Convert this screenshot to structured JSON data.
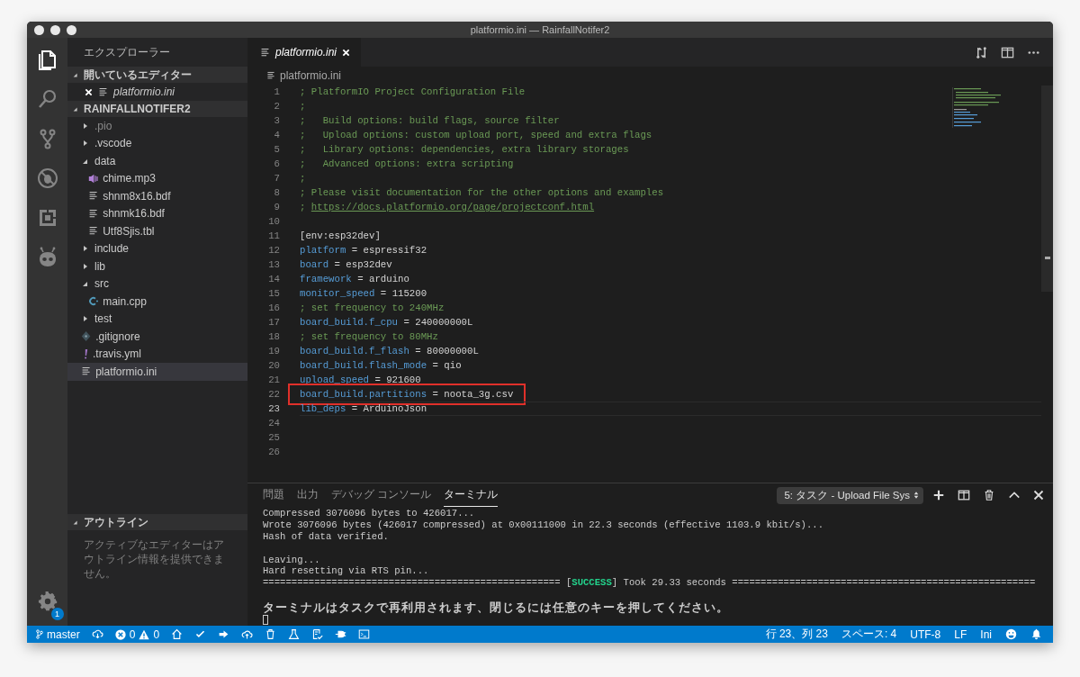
{
  "window": {
    "title": "platformio.ini — RainfallNotifer2"
  },
  "activity_bar": {
    "items": [
      {
        "kind": "files",
        "selected": true
      },
      {
        "kind": "search",
        "selected": false
      },
      {
        "kind": "scm",
        "selected": false
      },
      {
        "kind": "debug",
        "selected": false
      },
      {
        "kind": "extensions",
        "selected": false
      },
      {
        "kind": "platformio",
        "selected": false
      }
    ],
    "settings_badge": "1"
  },
  "explorer": {
    "title": "エクスプローラー",
    "open_editors": {
      "title": "開いているエディター",
      "expanded": true,
      "items": [
        {
          "name": "platformio.ini",
          "preview": true
        }
      ]
    },
    "project": {
      "title": "RAINFALLNOTIFER2",
      "expanded": true,
      "items": [
        {
          "name": ".pio",
          "kind": "folder",
          "expanded": false,
          "dimmed": true,
          "selected": false
        },
        {
          "name": ".vscode",
          "kind": "folder",
          "expanded": false,
          "dimmed": false,
          "selected": false
        },
        {
          "name": "data",
          "kind": "folder",
          "expanded": true,
          "dimmed": false,
          "selected": false,
          "children": [
            {
              "name": "chime.mp3",
              "kind": "audio",
              "dimmed": false,
              "selected": false
            },
            {
              "name": "shnm8x16.bdf",
              "kind": "text",
              "dimmed": false,
              "selected": false
            },
            {
              "name": "shnmk16.bdf",
              "kind": "text",
              "dimmed": false,
              "selected": false
            },
            {
              "name": "Utf8Sjis.tbl",
              "kind": "text",
              "dimmed": false,
              "selected": false
            }
          ]
        },
        {
          "name": "include",
          "kind": "folder",
          "expanded": false,
          "dimmed": false,
          "selected": false
        },
        {
          "name": "lib",
          "kind": "folder",
          "expanded": false,
          "dimmed": false,
          "selected": false
        },
        {
          "name": "src",
          "kind": "folder",
          "expanded": true,
          "dimmed": false,
          "selected": false,
          "children": [
            {
              "name": "main.cpp",
              "kind": "cpp",
              "dimmed": false,
              "selected": false
            }
          ]
        },
        {
          "name": "test",
          "kind": "folder",
          "expanded": false,
          "dimmed": false,
          "selected": false
        },
        {
          "name": ".gitignore",
          "kind": "git",
          "dimmed": false,
          "selected": false
        },
        {
          "name": ".travis.yml",
          "kind": "yaml",
          "dimmed": false,
          "selected": false
        },
        {
          "name": "platformio.ini",
          "kind": "text",
          "dimmed": false,
          "selected": true
        }
      ]
    },
    "outline": {
      "title": "アウトライン",
      "expanded": true,
      "message": "アクティブなエディターはアウトライン情報を提供できません。"
    }
  },
  "editor": {
    "tabs": [
      {
        "name": "platformio.ini",
        "preview": true,
        "selected": true
      }
    ],
    "breadcrumb": "platformio.ini",
    "lines": [
      {
        "number": "1",
        "current": false,
        "boxed": false,
        "tokens": [
          {
            "kind": "comment",
            "text": "; PlatformIO Project Configuration File"
          }
        ]
      },
      {
        "number": "2",
        "current": false,
        "boxed": false,
        "tokens": [
          {
            "kind": "comment",
            "text": ";"
          }
        ]
      },
      {
        "number": "3",
        "current": false,
        "boxed": false,
        "tokens": [
          {
            "kind": "comment",
            "text": ";   Build options: build flags, source filter"
          }
        ]
      },
      {
        "number": "4",
        "current": false,
        "boxed": false,
        "tokens": [
          {
            "kind": "comment",
            "text": ";   Upload options: custom upload port, speed and extra flags"
          }
        ]
      },
      {
        "number": "5",
        "current": false,
        "boxed": false,
        "tokens": [
          {
            "kind": "comment",
            "text": ";   Library options: dependencies, extra library storages"
          }
        ]
      },
      {
        "number": "6",
        "current": false,
        "boxed": false,
        "tokens": [
          {
            "kind": "comment",
            "text": ";   Advanced options: extra scripting"
          }
        ]
      },
      {
        "number": "7",
        "current": false,
        "boxed": false,
        "tokens": [
          {
            "kind": "comment",
            "text": ";"
          }
        ]
      },
      {
        "number": "8",
        "current": false,
        "boxed": false,
        "tokens": [
          {
            "kind": "comment",
            "text": "; Please visit documentation for the other options and examples"
          }
        ]
      },
      {
        "number": "9",
        "current": false,
        "boxed": false,
        "tokens": [
          {
            "kind": "comment",
            "text": "; "
          },
          {
            "kind": "link",
            "text": "https://docs.platformio.org/page/projectconf.html"
          }
        ]
      },
      {
        "number": "10",
        "current": false,
        "boxed": false
      },
      {
        "number": "11",
        "current": false,
        "boxed": false,
        "tokens": [
          {
            "kind": "value",
            "text": "[env:esp32dev]"
          }
        ]
      },
      {
        "number": "12",
        "current": false,
        "boxed": false,
        "tokens": [
          {
            "kind": "key",
            "text": "platform"
          },
          {
            "kind": "value",
            "text": " = espressif32"
          }
        ]
      },
      {
        "number": "13",
        "current": false,
        "boxed": false,
        "tokens": [
          {
            "kind": "key",
            "text": "board"
          },
          {
            "kind": "value",
            "text": " = esp32dev"
          }
        ]
      },
      {
        "number": "14",
        "current": false,
        "boxed": false,
        "tokens": [
          {
            "kind": "key",
            "text": "framework"
          },
          {
            "kind": "value",
            "text": " = arduino"
          }
        ]
      },
      {
        "number": "15",
        "current": false,
        "boxed": false,
        "tokens": [
          {
            "kind": "key",
            "text": "monitor_speed"
          },
          {
            "kind": "value",
            "text": " = 115200"
          }
        ]
      },
      {
        "number": "16",
        "current": false,
        "boxed": false,
        "tokens": [
          {
            "kind": "comment",
            "text": "; set frequency to 240MHz"
          }
        ]
      },
      {
        "number": "17",
        "current": false,
        "boxed": false,
        "tokens": [
          {
            "kind": "key",
            "text": "board_build.f_cpu"
          },
          {
            "kind": "value",
            "text": " = 240000000L"
          }
        ]
      },
      {
        "number": "18",
        "current": false,
        "boxed": false,
        "tokens": [
          {
            "kind": "comment",
            "text": "; set frequency to 80MHz"
          }
        ]
      },
      {
        "number": "19",
        "current": false,
        "boxed": false,
        "tokens": [
          {
            "kind": "key",
            "text": "board_build.f_flash"
          },
          {
            "kind": "value",
            "text": " = 80000000L"
          }
        ]
      },
      {
        "number": "20",
        "current": false,
        "boxed": false,
        "tokens": [
          {
            "kind": "key",
            "text": "board_build.flash_mode"
          },
          {
            "kind": "value",
            "text": " = qio"
          }
        ]
      },
      {
        "number": "21",
        "current": false,
        "boxed": false,
        "tokens": [
          {
            "kind": "key",
            "text": "upload_speed"
          },
          {
            "kind": "value",
            "text": " = 921600"
          }
        ]
      },
      {
        "number": "22",
        "current": false,
        "boxed": true,
        "tokens": [
          {
            "kind": "key",
            "text": "board_build.partitions"
          },
          {
            "kind": "value",
            "text": " = noota_3g.csv"
          }
        ]
      },
      {
        "number": "23",
        "current": true,
        "boxed": false,
        "tokens": [
          {
            "kind": "key",
            "text": "lib_deps"
          },
          {
            "kind": "value",
            "text": " = ArduinoJson"
          }
        ]
      },
      {
        "number": "24",
        "current": false,
        "boxed": false
      },
      {
        "number": "25",
        "current": false,
        "boxed": false
      },
      {
        "number": "26",
        "current": false,
        "boxed": false
      }
    ]
  },
  "panel": {
    "tabs": [
      {
        "label": "問題",
        "selected": false
      },
      {
        "label": "出力",
        "selected": false
      },
      {
        "label": "デバッグ コンソール",
        "selected": false
      },
      {
        "label": "ターミナル",
        "selected": true
      }
    ],
    "task_select": "5: タスク - Upload File Sys",
    "terminal": [
      {
        "kind": "text",
        "text": "Compressed 3076096 bytes to 426017..."
      },
      {
        "kind": "text",
        "text": "Wrote 3076096 bytes (426017 compressed) at 0x00111000 in 22.3 seconds (effective 1103.9 kbit/s)..."
      },
      {
        "kind": "text",
        "text": "Hash of data verified."
      },
      {
        "kind": "blank"
      },
      {
        "kind": "text",
        "text": "Leaving..."
      },
      {
        "kind": "text",
        "text": "Hard resetting via RTS pin..."
      },
      {
        "kind": "status",
        "before": "==================================================== [",
        "status": "SUCCESS",
        "after": "] Took 29.33 seconds ====================================================="
      },
      {
        "kind": "blank"
      },
      {
        "kind": "notice",
        "text": "ターミナルはタスクで再利用されます、閉じるには任意のキーを押してください。"
      },
      {
        "kind": "cursor"
      }
    ]
  },
  "status_bar": {
    "left": [
      {
        "kind": "branch",
        "text": "master"
      },
      {
        "kind": "sync"
      },
      {
        "kind": "problems",
        "errors": "0",
        "warnings": "0"
      },
      {
        "kind": "home"
      },
      {
        "kind": "check"
      },
      {
        "kind": "arrow"
      },
      {
        "kind": "upload"
      },
      {
        "kind": "trash"
      },
      {
        "kind": "flask"
      },
      {
        "kind": "checklist"
      },
      {
        "kind": "plug"
      },
      {
        "kind": "terminal"
      }
    ],
    "right": [
      {
        "kind": "text",
        "text": "行 23、列 23"
      },
      {
        "kind": "text",
        "text": "スペース: 4"
      },
      {
        "kind": "text",
        "text": "UTF-8"
      },
      {
        "kind": "text",
        "text": "LF"
      },
      {
        "kind": "text",
        "text": "Ini"
      },
      {
        "kind": "smiley"
      },
      {
        "kind": "bell"
      }
    ]
  }
}
